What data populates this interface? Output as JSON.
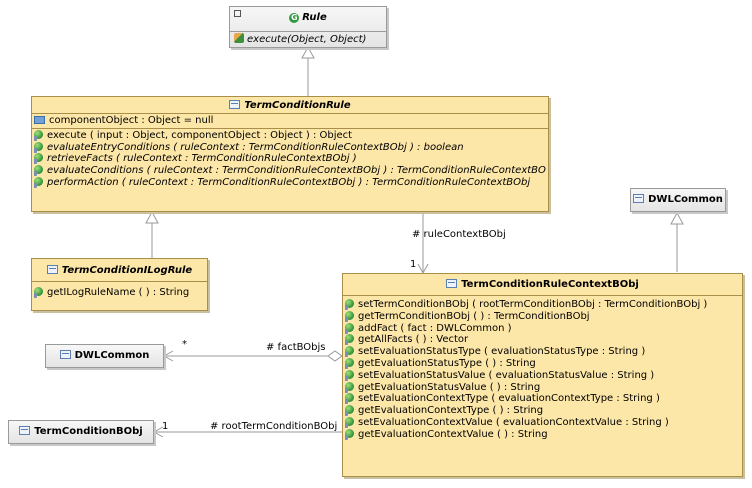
{
  "rule": {
    "name": "Rule",
    "method": "execute(Object, Object)"
  },
  "term_condition_rule": {
    "name": "TermConditionRule",
    "attribute": "componentObject : Object = null",
    "methods": [
      "execute ( input : Object, componentObject : Object ) : Object",
      "evaluateEntryConditions ( ruleContext : TermConditionRuleContextBObj ) : boolean",
      "retrieveFacts ( ruleContext : TermConditionRuleContextBObj )",
      "evaluateConditions ( ruleContext : TermConditionRuleContextBObj ) : TermConditionRuleContextBObj",
      "performAction ( ruleContext : TermConditionRuleContextBObj ) : TermConditionRuleContextBObj"
    ]
  },
  "ilog_rule": {
    "name": "TermConditionILogRule",
    "method": "getILogRuleName ( ) : String"
  },
  "dwl_common_right": {
    "name": "DWLCommon"
  },
  "dwl_common_left": {
    "name": "DWLCommon"
  },
  "term_condition_bobj": {
    "name": "TermConditionBObj"
  },
  "context_bobj": {
    "name": "TermConditionRuleContextBObj",
    "methods": [
      "setTermConditionBObj ( rootTermConditionBObj : TermConditionBObj )",
      "getTermConditionBObj ( ) : TermConditionBObj",
      "addFact ( fact : DWLCommon )",
      "getAllFacts ( ) : Vector",
      "setEvaluationStatusType ( evaluationStatusType : String )",
      "getEvaluationStatusType ( ) : String",
      "setEvaluationStatusValue ( evaluationStatusValue : String )",
      "getEvaluationStatusValue ( ) : String",
      "setEvaluationContextType ( evaluationContextType : String )",
      "getEvaluationContextType ( ) : String",
      "setEvaluationContextValue ( evaluationContextValue : String )",
      "getEvaluationContextValue ( ) : String"
    ]
  },
  "associations": {
    "rule_context": {
      "role": "# ruleContextBObj",
      "multiplicity": "1"
    },
    "facts": {
      "role": "# factBObjs",
      "multiplicity": "*"
    },
    "root": {
      "role": "# rootTermConditionBObj",
      "multiplicity": "1"
    }
  }
}
